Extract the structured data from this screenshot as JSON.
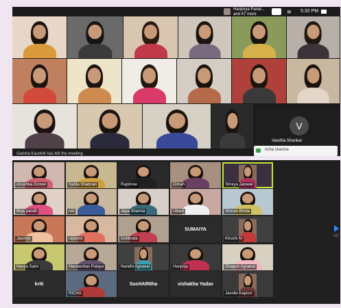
{
  "top": {
    "status": {
      "participant_name": "Hanjmya Panal...",
      "more_count": "and 47 more",
      "time": "5:32 PM"
    },
    "toast": "Garima Kaushik has left the meeting",
    "avatar_tile": {
      "letter": "V",
      "name": "Vandha Shankar"
    },
    "chat_popup": {
      "name": "richa sharma"
    }
  },
  "bottom": {
    "names": [
      "Anushka Grover",
      "Nahla Shabnan",
      "Rajshree",
      "Dimah",
      "Shreya Jaiswal",
      "Brija pandit",
      "rok",
      "Jaya Sharma",
      "Uttam",
      "Simran Bhola",
      "Jasmyo",
      "rajlaxmi",
      "Debbrata",
      "SUMAIYA",
      "Khushi M",
      "Navya Saini",
      "Maneechas Pulaya",
      "Nandhi Agrawal",
      "Hanjmja",
      "Dhagun Agrawal",
      "kriti",
      "RICHA",
      "SucHARItha",
      "vishakha Yadav",
      "Jasolie Kapoor"
    ],
    "page_indicator": "1/2"
  },
  "colors": {
    "accent": "#2d8cff",
    "active_speaker": "#c8e63a",
    "background": "#efe6f1"
  }
}
